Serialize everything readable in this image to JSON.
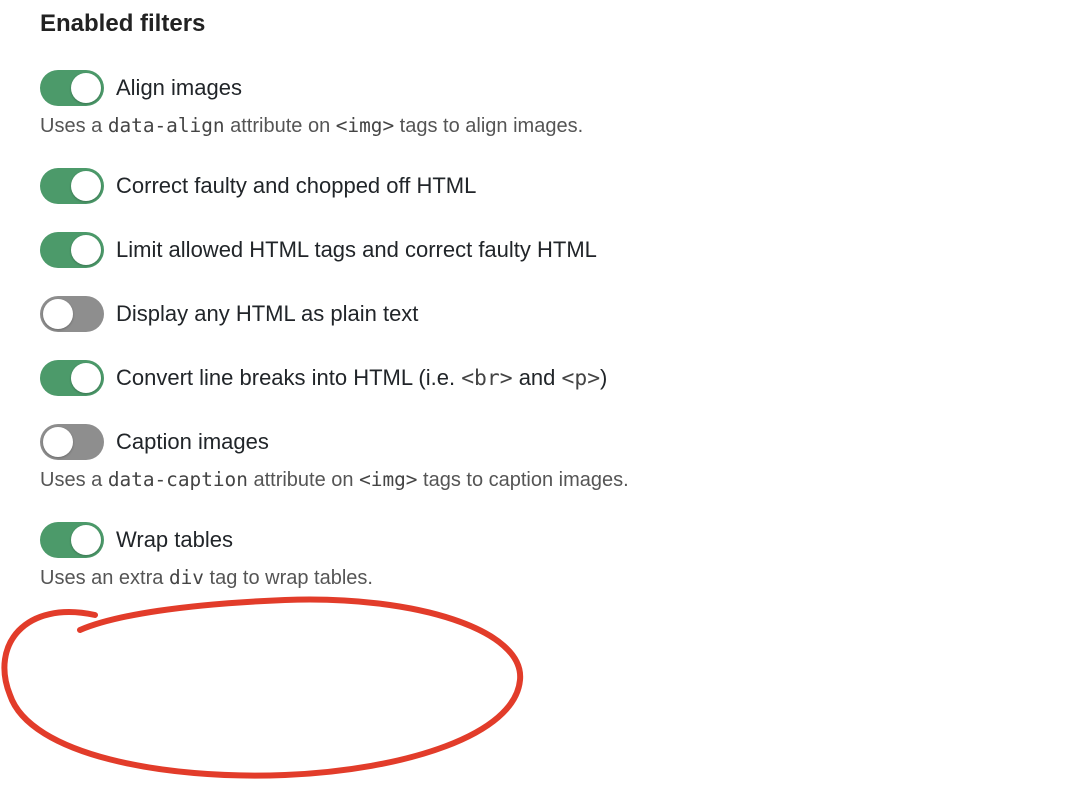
{
  "section_title": "Enabled filters",
  "colors": {
    "toggle_on": "#4c9a6a",
    "toggle_off": "#8e8e8e",
    "annotation": "#e23c2a"
  },
  "filters": [
    {
      "id": "align-images",
      "label": "Align images",
      "enabled": true,
      "description_html": "Uses a <code>data-align</code> attribute on <code>&lt;img&gt;</code> tags to align images."
    },
    {
      "id": "correct-faulty-html",
      "label": "Correct faulty and chopped off HTML",
      "enabled": true
    },
    {
      "id": "limit-allowed-html-tags",
      "label": "Limit allowed HTML tags and correct faulty HTML",
      "enabled": true
    },
    {
      "id": "display-any-html-plain-text",
      "label": "Display any HTML as plain text",
      "enabled": false
    },
    {
      "id": "convert-line-breaks",
      "label_html": "Convert line breaks into HTML (i.e. <code>&lt;br&gt;</code> and <code>&lt;p&gt;</code>)",
      "enabled": true
    },
    {
      "id": "caption-images",
      "label": "Caption images",
      "enabled": false,
      "description_html": "Uses a <code>data-caption</code> attribute on <code>&lt;img&gt;</code> tags to caption images."
    },
    {
      "id": "wrap-tables",
      "label": "Wrap tables",
      "enabled": true,
      "description_html": "Uses an extra <code>div</code> tag to wrap tables."
    }
  ],
  "annotation": {
    "target_filter_id": "wrap-tables",
    "shape": "rough-ellipse",
    "stroke_color": "#e23c2a"
  }
}
